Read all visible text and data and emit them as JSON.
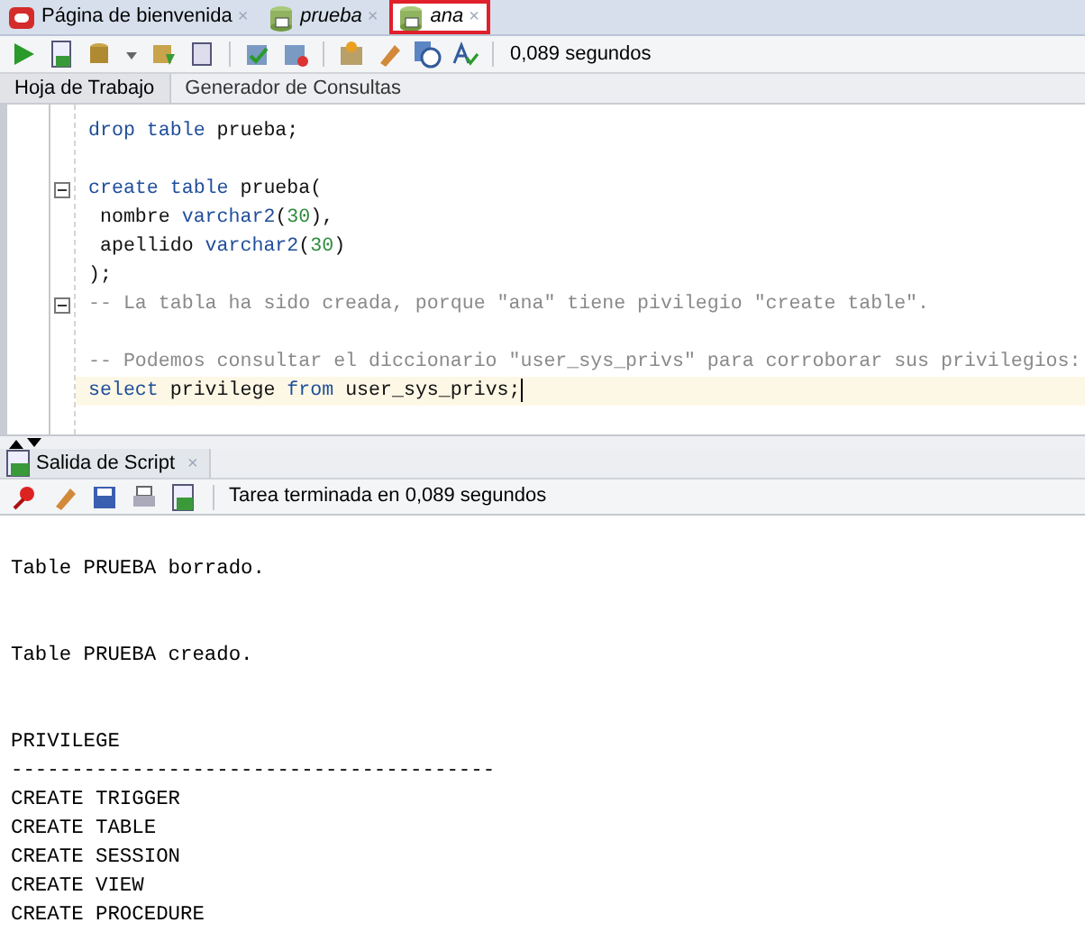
{
  "document_tabs": [
    {
      "label": "Página de bienvenida",
      "kind": "welcome",
      "selected": false,
      "italic": false
    },
    {
      "label": "prueba",
      "kind": "connection",
      "selected": false,
      "italic": true
    },
    {
      "label": "ana",
      "kind": "connection",
      "selected": true,
      "italic": true
    }
  ],
  "tab_close": "×",
  "toolbar": {
    "timing": "0,089 segundos"
  },
  "editor_tabs": [
    {
      "label": "Hoja de Trabajo",
      "selected": true
    },
    {
      "label": "Generador de Consultas",
      "selected": false
    }
  ],
  "code_lines": [
    {
      "fold": false,
      "current": false,
      "tokens": [
        {
          "kind": "kw",
          "text": "drop table"
        },
        {
          "kind": "plain",
          "text": " prueba;"
        }
      ]
    },
    {
      "kind": "blank"
    },
    {
      "fold": true,
      "current": false,
      "tokens": [
        {
          "kind": "kw",
          "text": "create table"
        },
        {
          "kind": "plain",
          "text": " prueba("
        }
      ]
    },
    {
      "fold": false,
      "current": false,
      "tokens": [
        {
          "kind": "plain",
          "text": " nombre "
        },
        {
          "kind": "kw",
          "text": "varchar2"
        },
        {
          "kind": "plain",
          "text": "("
        },
        {
          "kind": "num",
          "text": "30"
        },
        {
          "kind": "plain",
          "text": "),"
        }
      ]
    },
    {
      "fold": false,
      "current": false,
      "tokens": [
        {
          "kind": "plain",
          "text": " apellido "
        },
        {
          "kind": "kw",
          "text": "varchar2"
        },
        {
          "kind": "plain",
          "text": "("
        },
        {
          "kind": "num",
          "text": "30"
        },
        {
          "kind": "plain",
          "text": ")"
        }
      ]
    },
    {
      "fold": false,
      "current": false,
      "tokens": [
        {
          "kind": "plain",
          "text": ");"
        }
      ]
    },
    {
      "fold": true,
      "current": false,
      "tokens": [
        {
          "kind": "comment",
          "text": "-- La tabla ha sido creada, porque \"ana\" tiene pivilegio \"create table\"."
        }
      ]
    },
    {
      "kind": "blank"
    },
    {
      "fold": false,
      "current": false,
      "tokens": [
        {
          "kind": "comment",
          "text": "-- Podemos consultar el diccionario \"user_sys_privs\" para corroborar sus privilegios:"
        }
      ]
    },
    {
      "fold": false,
      "current": true,
      "tokens": [
        {
          "kind": "kw",
          "text": "select"
        },
        {
          "kind": "plain",
          "text": " privilege "
        },
        {
          "kind": "kw",
          "text": "from"
        },
        {
          "kind": "plain",
          "text": " user_sys_privs;"
        }
      ]
    }
  ],
  "output_panel": {
    "title": "Salida de Script",
    "close": "×",
    "status": "Tarea terminada en 0,089 segundos",
    "lines": [
      {
        "kind": "blank"
      },
      {
        "kind": "text",
        "text": "Table PRUEBA borrado."
      },
      {
        "kind": "blank"
      },
      {
        "kind": "blank"
      },
      {
        "kind": "text",
        "text": "Table PRUEBA creado."
      },
      {
        "kind": "blank"
      },
      {
        "kind": "blank"
      },
      "PRIVILEGE",
      "----------------------------------------",
      "CREATE TRIGGER",
      "CREATE TABLE",
      "CREATE SESSION",
      "CREATE VIEW",
      "CREATE PROCEDURE"
    ]
  }
}
